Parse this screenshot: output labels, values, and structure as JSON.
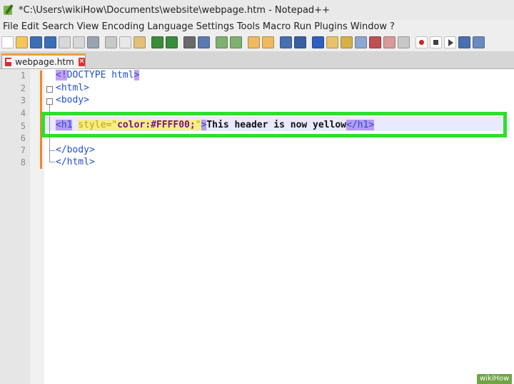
{
  "window": {
    "title": "*C:\\Users\\wikiHow\\Documents\\website\\webpage.htm - Notepad++"
  },
  "menu": [
    "File",
    "Edit",
    "Search",
    "View",
    "Encoding",
    "Language",
    "Settings",
    "Tools",
    "Macro",
    "Run",
    "Plugins",
    "Window",
    "?"
  ],
  "toolbar": {
    "buttons": [
      "new-file",
      "open-file",
      "save",
      "save-all",
      "close",
      "close-all",
      "print",
      "cut",
      "copy",
      "paste",
      "undo",
      "redo",
      "find",
      "replace",
      "zoom-in",
      "zoom-out",
      "sync-vertical",
      "sync-horizontal",
      "word-wrap",
      "show-all-chars",
      "indent-guide",
      "user-language",
      "doc-map",
      "function-list",
      "folder-workspace",
      "monitoring",
      "record-macro",
      "stop-record",
      "play-macro",
      "run-multiple",
      "save-macro"
    ]
  },
  "tab": {
    "label": "webpage.htm",
    "close": "✕"
  },
  "editor": {
    "line_numbers": [
      "1",
      "2",
      "3",
      "4",
      "5",
      "6",
      "7",
      "8"
    ],
    "line1": {
      "open": "<!",
      "rest": "DOCTYPE html",
      "close": ">"
    },
    "line2": "<html>",
    "line3": "<body>",
    "line5": {
      "tag_open": "<h1",
      "space": " ",
      "attr": "style=",
      "quote1": "\"",
      "value": "color:#FFFF00;",
      "quote2": "\"",
      "gt": ">",
      "text": "This header is now yellow",
      "tag_close": "</h1>"
    },
    "line7": "</body>",
    "line8": "</html>"
  },
  "watermark": "wikiHow"
}
